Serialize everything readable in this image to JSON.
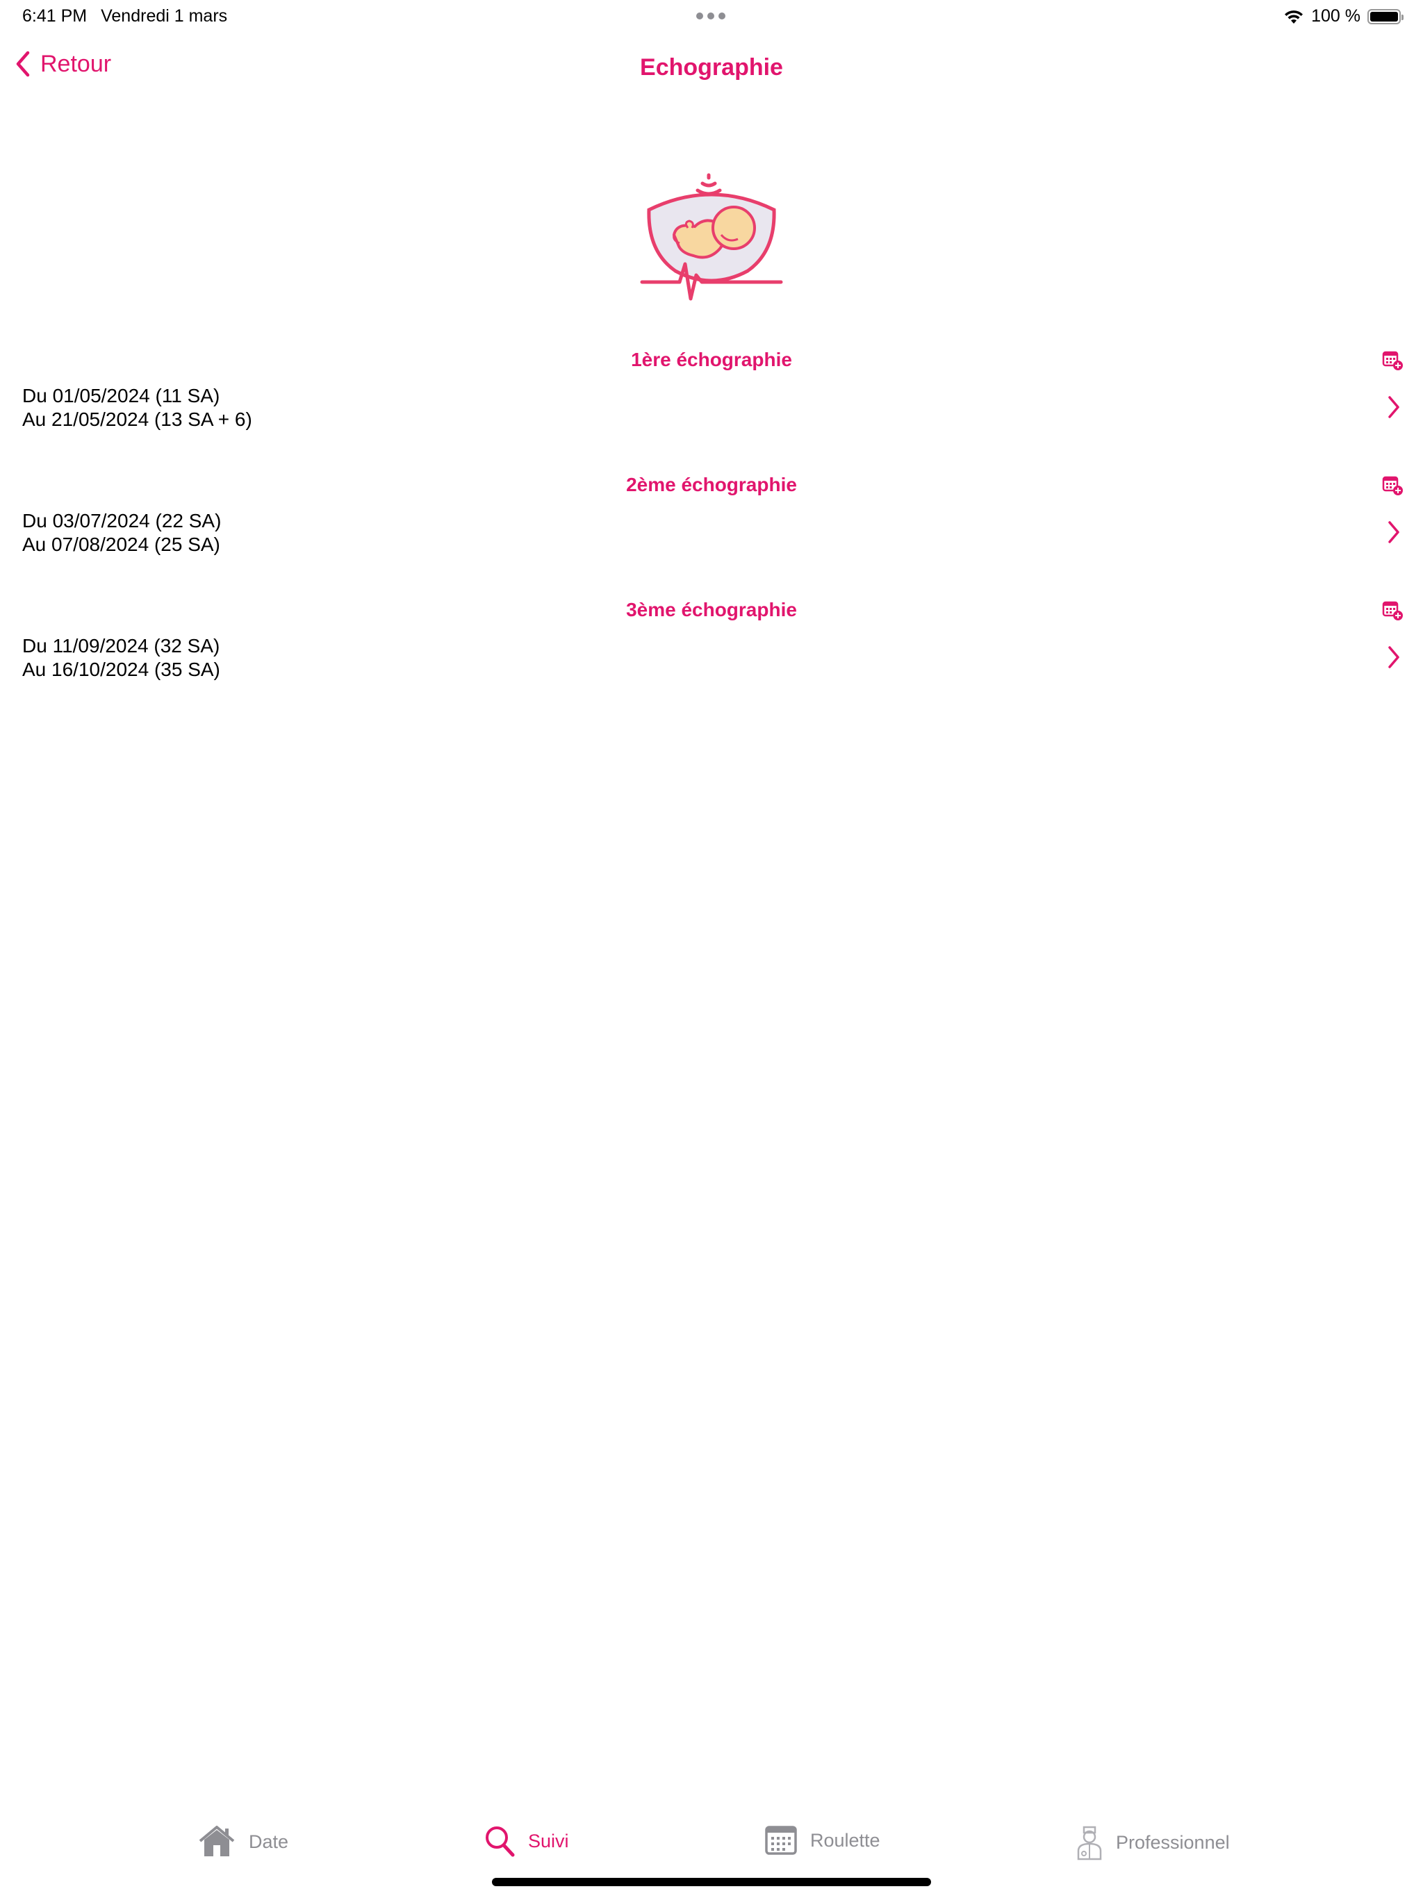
{
  "status_bar": {
    "time": "6:41 PM",
    "date": "Vendredi 1 mars",
    "battery_text": "100 %",
    "battery_level": 1.0
  },
  "nav": {
    "back_label": "Retour",
    "title": "Echographie"
  },
  "hero": {
    "icon": "ultrasound-baby-icon"
  },
  "sections": [
    {
      "title": "1ère échographie",
      "line1": "Du 01/05/2024 (11 SA)",
      "line2": "Au 21/05/2024 (13 SA + 6)"
    },
    {
      "title": "2ème échographie",
      "line1": "Du 03/07/2024 (22 SA)",
      "line2": "Au 07/08/2024 (25 SA)"
    },
    {
      "title": "3ème échographie",
      "line1": "Du 11/09/2024 (32 SA)",
      "line2": "Au 16/10/2024 (35 SA)"
    }
  ],
  "tabs": [
    {
      "label": "Date",
      "icon": "home-icon",
      "active": false
    },
    {
      "label": "Suivi",
      "icon": "search-icon",
      "active": true
    },
    {
      "label": "Roulette",
      "icon": "calendar-icon",
      "active": false
    },
    {
      "label": "Professionnel",
      "icon": "doctor-icon",
      "active": false
    }
  ],
  "colors": {
    "accent": "#e1156d",
    "inactive": "#8e8e93",
    "text": "#000000",
    "background": "#ffffff"
  }
}
